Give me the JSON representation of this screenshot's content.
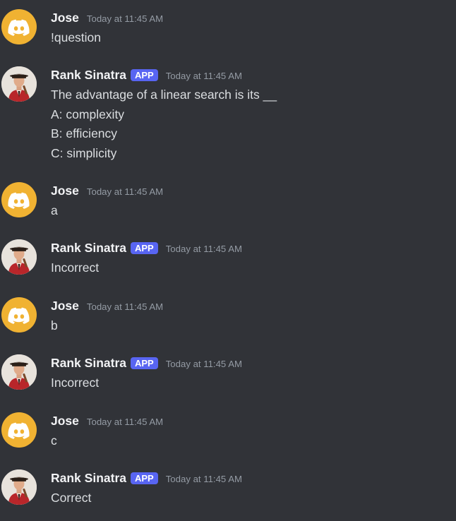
{
  "messages": [
    {
      "author": "Jose",
      "avatar": "discord-logo-icon",
      "app": false,
      "timestamp": "Today at 11:45 AM",
      "lines": [
        "!question"
      ]
    },
    {
      "author": "Rank Sinatra",
      "avatar": "sinatra-photo-avatar",
      "app": true,
      "badge": "APP",
      "timestamp": "Today at 11:45 AM",
      "lines": [
        "The advantage of a linear search is its __",
        "A: complexity",
        "B:  efficiency",
        "C:  simplicity"
      ]
    },
    {
      "author": "Jose",
      "avatar": "discord-logo-icon",
      "app": false,
      "timestamp": "Today at 11:45 AM",
      "lines": [
        "a"
      ]
    },
    {
      "author": "Rank Sinatra",
      "avatar": "sinatra-photo-avatar",
      "app": true,
      "badge": "APP",
      "timestamp": "Today at 11:45 AM",
      "lines": [
        "Incorrect"
      ]
    },
    {
      "author": "Jose",
      "avatar": "discord-logo-icon",
      "app": false,
      "timestamp": "Today at 11:45 AM",
      "lines": [
        "b"
      ]
    },
    {
      "author": "Rank Sinatra",
      "avatar": "sinatra-photo-avatar",
      "app": true,
      "badge": "APP",
      "timestamp": "Today at 11:45 AM",
      "lines": [
        "Incorrect"
      ]
    },
    {
      "author": "Jose",
      "avatar": "discord-logo-icon",
      "app": false,
      "timestamp": "Today at 11:45 AM",
      "lines": [
        "c"
      ]
    },
    {
      "author": "Rank Sinatra",
      "avatar": "sinatra-photo-avatar",
      "app": true,
      "badge": "APP",
      "timestamp": "Today at 11:45 AM",
      "lines": [
        "Correct"
      ]
    }
  ],
  "colors": {
    "background": "#313338",
    "discord_avatar": "#f0b232",
    "app_badge": "#5865f2",
    "username": "#f2f3f5",
    "timestamp": "#949ba4",
    "text": "#dbdee1"
  }
}
